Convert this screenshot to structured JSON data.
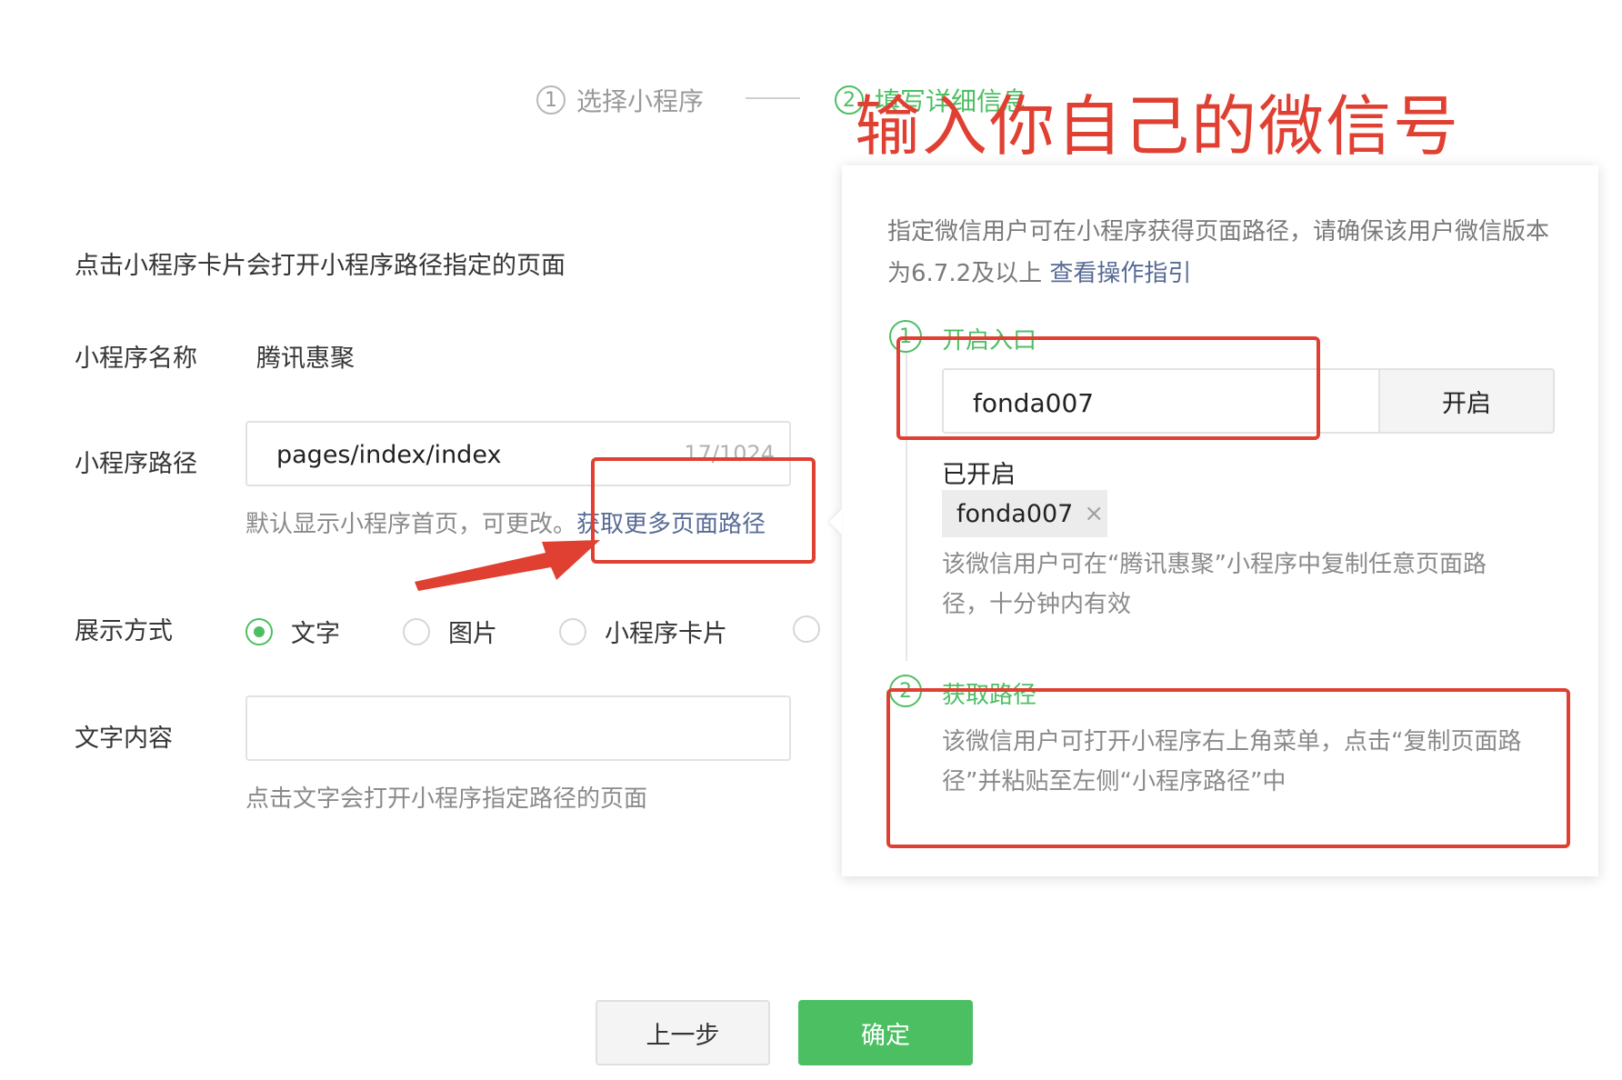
{
  "steps": [
    {
      "num": "1",
      "label": "选择小程序"
    },
    {
      "num": "2",
      "label": "填写详细信息"
    }
  ],
  "annotation": "输入你自己的微信号",
  "form": {
    "intro": "点击小程序卡片会打开小程序路径指定的页面",
    "name_label": "小程序名称",
    "name_value": "腾讯惠聚",
    "path_label": "小程序路径",
    "path_value": "pages/index/index",
    "path_counter": "17/1024",
    "path_hint": "默认显示小程序首页，可更改。",
    "path_link": "获取更多页面路径",
    "display_label": "展示方式",
    "display_options": [
      "文字",
      "图片",
      "小程序卡片"
    ],
    "text_label": "文字内容",
    "text_value": "",
    "text_hint": "点击文字会打开小程序指定路径的页面"
  },
  "buttons": {
    "prev": "上一步",
    "confirm": "确定"
  },
  "panel": {
    "desc": "指定微信用户可在小程序获得页面路径，请确保该用户微信版本为6.7.2及以上",
    "guide_link": "查看操作指引",
    "step1_num": "1",
    "step1_title": "开启入口",
    "wechat_value": "fonda007",
    "open_button": "开启",
    "opened_label": "已开启",
    "tag_value": "fonda007",
    "tag_close": "×",
    "step1_note": "该微信用户可在“腾讯惠聚”小程序中复制任意页面路径，十分钟内有效",
    "step2_num": "2",
    "step2_title": "获取路径",
    "step2_note": "该微信用户可打开小程序右上角菜单，点击“复制页面路径”并粘贴至左侧“小程序路径”中"
  },
  "colors": {
    "accent": "#4cbf63",
    "link": "#576b95",
    "annotation": "#e04032"
  }
}
